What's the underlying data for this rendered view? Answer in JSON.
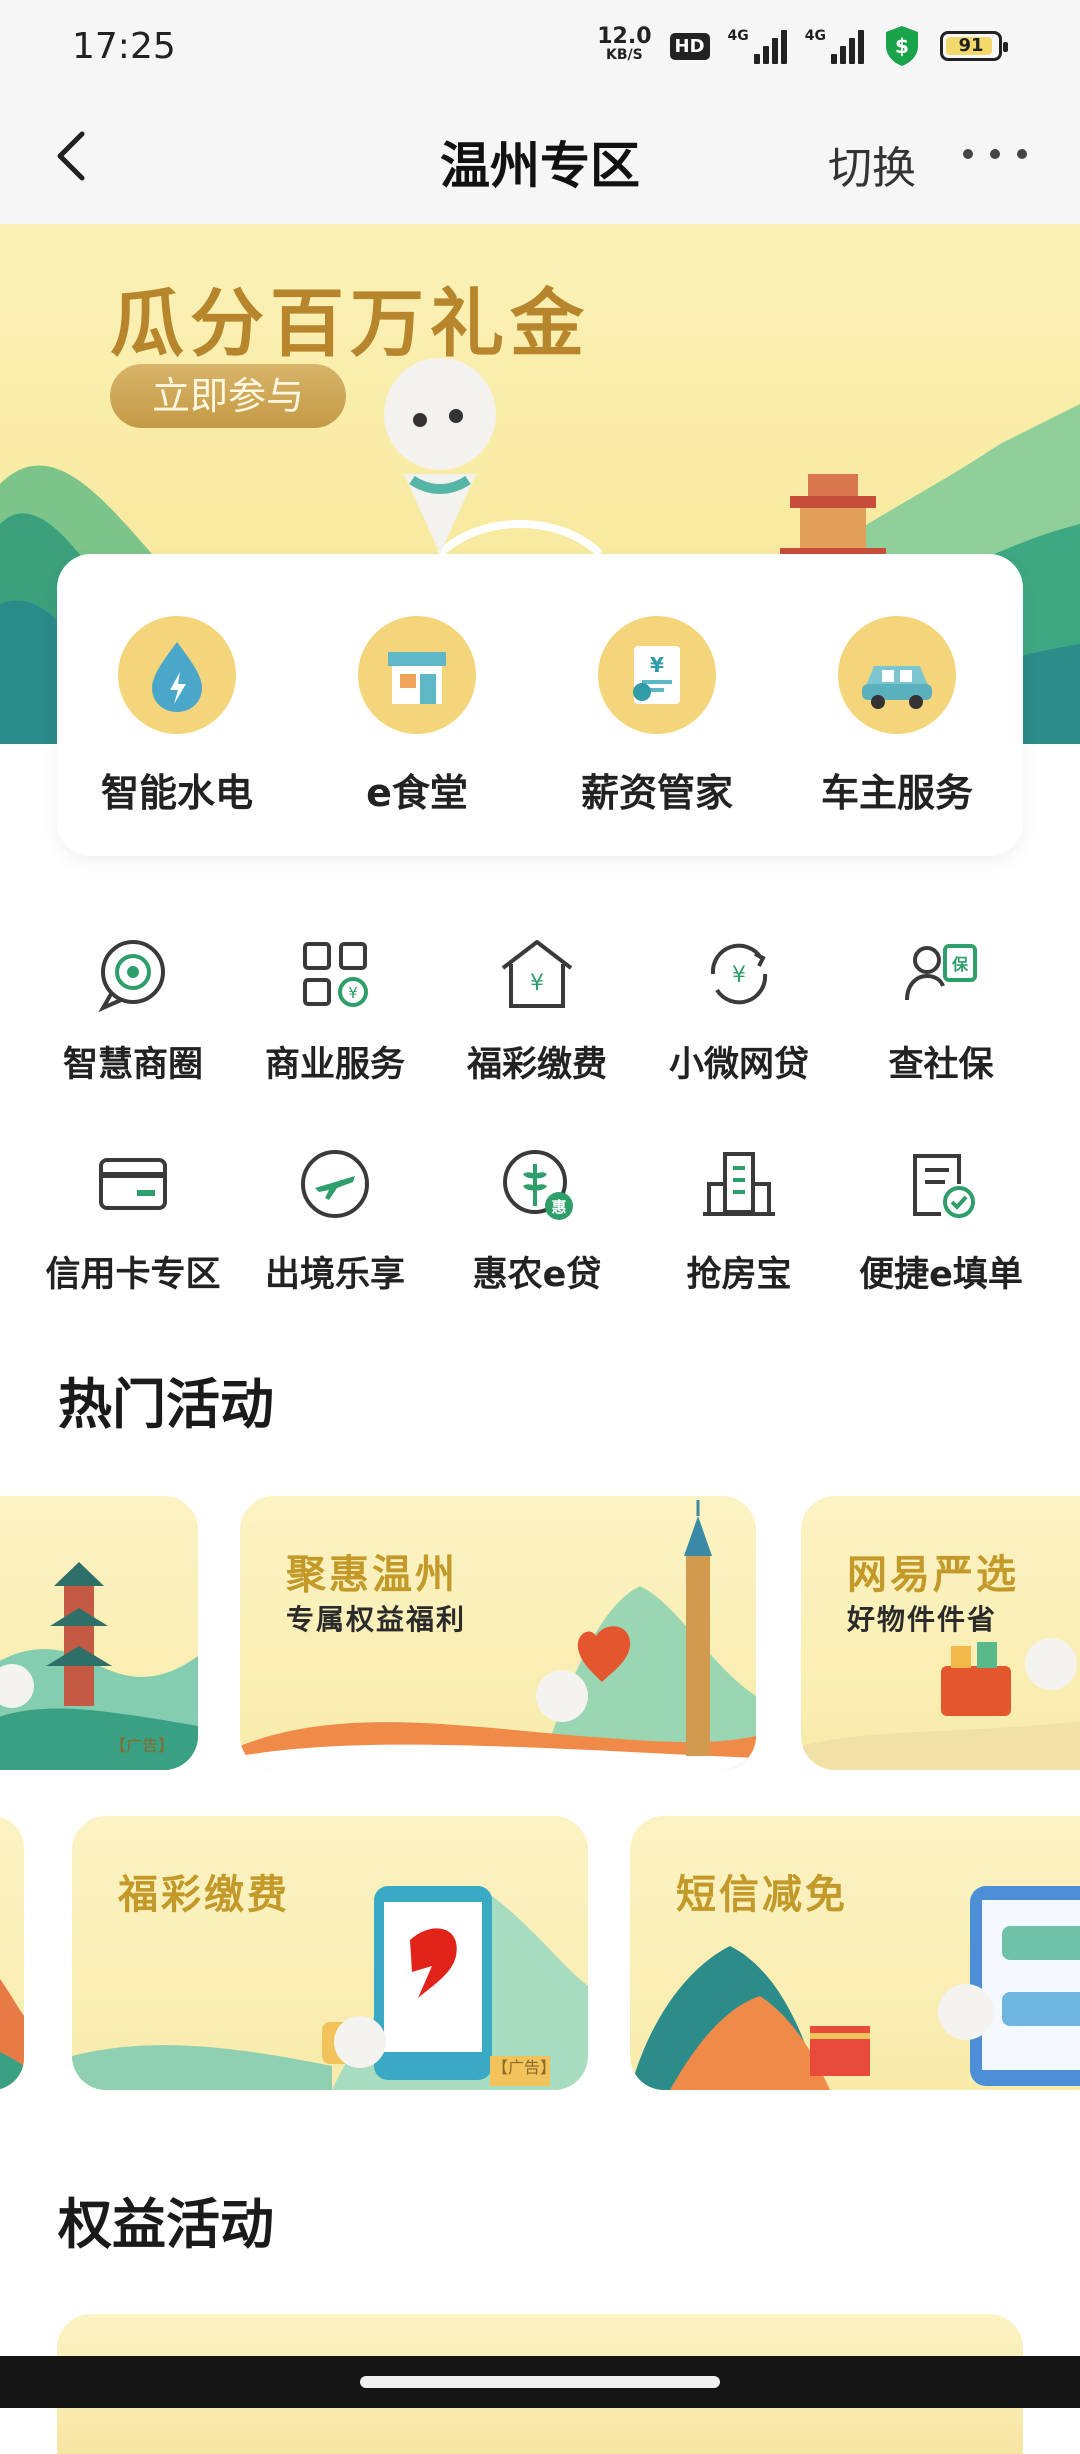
{
  "status_bar": {
    "time": "17:25",
    "net_speed_value": "12.0",
    "net_speed_unit": "KB/S",
    "hd_label": "HD",
    "signal1_label": "4G",
    "signal2_label": "4G",
    "battery": "91"
  },
  "nav": {
    "title": "温州专区",
    "switch_label": "切换"
  },
  "banner": {
    "title": "瓜分百万礼金",
    "button": "立即参与"
  },
  "top_services": [
    {
      "label": "智能水电",
      "icon": "water-electric-icon"
    },
    {
      "label": "e食堂",
      "icon": "canteen-icon"
    },
    {
      "label": "薪资管家",
      "icon": "salary-icon"
    },
    {
      "label": "车主服务",
      "icon": "car-icon"
    }
  ],
  "grid_row1": [
    {
      "label": "智慧商圈",
      "icon": "smart-business-icon"
    },
    {
      "label": "商业服务",
      "icon": "business-service-icon"
    },
    {
      "label": "福彩缴费",
      "icon": "lottery-pay-icon"
    },
    {
      "label": "小微网贷",
      "icon": "micro-loan-icon"
    },
    {
      "label": "查社保",
      "icon": "social-security-icon"
    }
  ],
  "grid_row2": [
    {
      "label": "信用卡专区",
      "icon": "credit-card-icon"
    },
    {
      "label": "出境乐享",
      "icon": "airplane-icon"
    },
    {
      "label": "惠农e贷",
      "icon": "agri-loan-icon"
    },
    {
      "label": "抢房宝",
      "icon": "building-icon"
    },
    {
      "label": "便捷e填单",
      "icon": "form-icon"
    }
  ],
  "hot_section_title": "热门活动",
  "hot_cards_row1": [
    {
      "title": "聚惠温州",
      "subtitle": "专属权益福利"
    },
    {
      "title": "网易严选",
      "subtitle": "好物件件省"
    }
  ],
  "hot_cards_row2": [
    {
      "title": "福彩缴费"
    },
    {
      "title": "短信减免"
    }
  ],
  "ad_label": "【广告】",
  "benefit_section_title": "权益活动",
  "colors": {
    "accent_green": "#2e9e6a",
    "gold": "#c39a2a",
    "banner_bg": "#fbf1b8"
  }
}
